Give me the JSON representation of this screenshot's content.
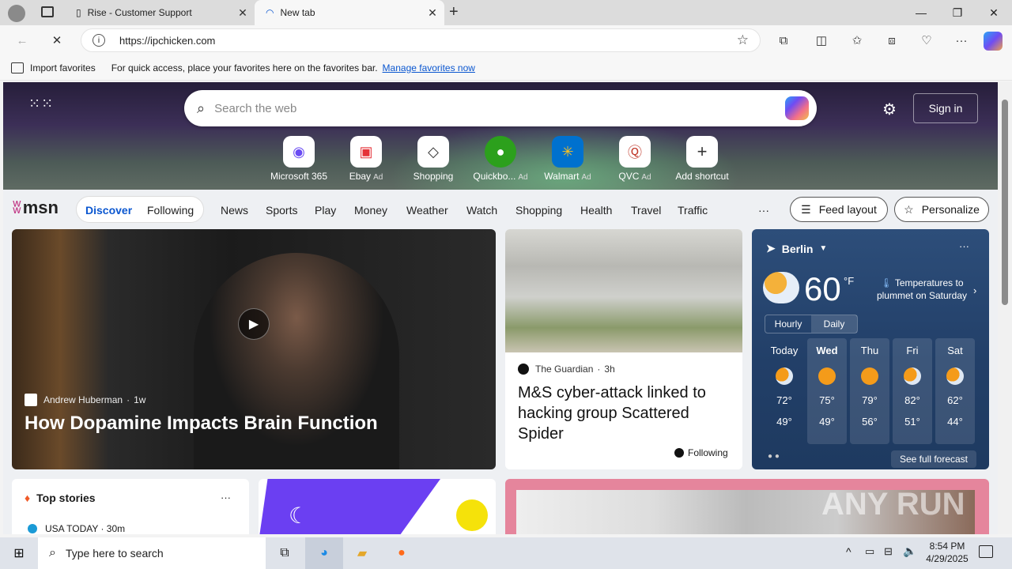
{
  "browser": {
    "tabs": [
      {
        "label": "Rise - Customer Support"
      },
      {
        "label": "New tab"
      }
    ],
    "url": "https://ipchicken.com",
    "favorites_bar": {
      "import": "Import favorites",
      "hint": "For quick access, place your favorites here on the favorites bar.",
      "manage_link": "Manage favorites now"
    }
  },
  "hero": {
    "search_placeholder": "Search the web",
    "sign_in": "Sign in",
    "shortcuts": [
      {
        "label": "Microsoft 365",
        "ad": "",
        "icon": "m365-icon"
      },
      {
        "label": "Ebay",
        "ad": "Ad",
        "icon": "ebay-icon"
      },
      {
        "label": "Shopping",
        "ad": "",
        "icon": "tag-icon"
      },
      {
        "label": "Quickbo...",
        "ad": "Ad",
        "icon": "quickbooks-icon"
      },
      {
        "label": "Walmart",
        "ad": "Ad",
        "icon": "walmart-icon"
      },
      {
        "label": "QVC",
        "ad": "Ad",
        "icon": "qvc-icon"
      },
      {
        "label": "Add shortcut",
        "ad": "",
        "icon": "plus-icon"
      }
    ]
  },
  "nav": {
    "brand": "msn",
    "discover": "Discover",
    "following": "Following",
    "items": [
      "News",
      "Sports",
      "Play",
      "Money",
      "Weather",
      "Watch",
      "Shopping",
      "Health",
      "Travel",
      "Traffic"
    ],
    "more": "···",
    "feed_layout": "Feed layout",
    "personalize": "Personalize"
  },
  "lead_story": {
    "source": "Andrew Huberman",
    "age": "1w",
    "title": "How Dopamine Impacts Brain Function"
  },
  "story2": {
    "source": "The Guardian",
    "age": "3h",
    "title": "M&S cyber-attack linked to hacking group Scattered Spider",
    "following": "Following"
  },
  "weather": {
    "city": "Berlin",
    "temp": "60",
    "unit": "°F",
    "alert": "Temperatures to plummet on Saturday",
    "tab_hourly": "Hourly",
    "tab_daily": "Daily",
    "days": [
      {
        "name": "Today",
        "hi": "72°",
        "lo": "49°",
        "icon": "partly-cloudy-icon"
      },
      {
        "name": "Wed",
        "hi": "75°",
        "lo": "49°",
        "icon": "sunny-icon"
      },
      {
        "name": "Thu",
        "hi": "79°",
        "lo": "56°",
        "icon": "sunny-icon"
      },
      {
        "name": "Fri",
        "hi": "82°",
        "lo": "51°",
        "icon": "partly-sunny-icon"
      },
      {
        "name": "Sat",
        "hi": "62°",
        "lo": "44°",
        "icon": "partly-cloudy-icon"
      }
    ],
    "see_full": "See full forecast"
  },
  "bottom": {
    "top_stories": "Top stories",
    "usa_today": "USA TODAY · 30m"
  },
  "taskbar": {
    "search_placeholder": "Type here to search",
    "time": "8:54 PM",
    "date": "4/29/2025"
  },
  "watermark": "ANY RUN"
}
